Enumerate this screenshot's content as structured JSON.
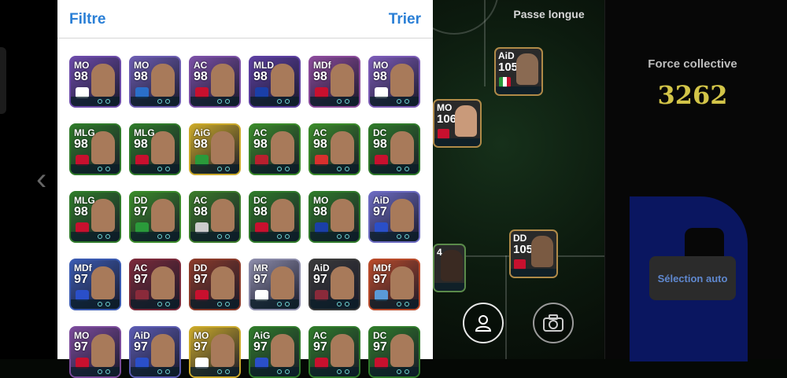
{
  "header": {
    "filter_label": "Filtre",
    "sort_label": "Trier"
  },
  "pitch": {
    "stat_label": "Passe longue"
  },
  "team": {
    "strength_label": "Force collective",
    "strength_value": "3262",
    "auto_select_label": "Sélection auto"
  },
  "nav": {
    "back_icon": "chevron-left-icon"
  },
  "buttons": {
    "profile_icon": "person-icon",
    "camera_icon": "camera-icon"
  },
  "player_grid": [
    {
      "pos": "MO",
      "rating": "98",
      "bg": "#6b4aa8",
      "emblem": "#ffffff"
    },
    {
      "pos": "MO",
      "rating": "98",
      "bg": "#6b5cb0",
      "emblem": "#2a6fc9"
    },
    {
      "pos": "AC",
      "rating": "98",
      "bg": "#7a4fa5",
      "emblem": "#c8102e"
    },
    {
      "pos": "MLD",
      "rating": "98",
      "bg": "#5c3fa0",
      "emblem": "#1a3fa8"
    },
    {
      "pos": "MDf",
      "rating": "98",
      "bg": "#8a4a9a",
      "emblem": "#c8102e"
    },
    {
      "pos": "MO",
      "rating": "98",
      "bg": "#7a5ab5",
      "emblem": "#ffffff"
    },
    {
      "pos": "MLG",
      "rating": "98",
      "bg": "#2f7a2a",
      "emblem": "#c8102e"
    },
    {
      "pos": "MLG",
      "rating": "98",
      "bg": "#2f7a2a",
      "emblem": "#c8102e"
    },
    {
      "pos": "AiG",
      "rating": "98",
      "bg": "#c9a82a",
      "emblem": "#2a9a3a"
    },
    {
      "pos": "AC",
      "rating": "98",
      "bg": "#3a8a2a",
      "emblem": "#b8202e"
    },
    {
      "pos": "AC",
      "rating": "98",
      "bg": "#3a8a2a",
      "emblem": "#d8302e"
    },
    {
      "pos": "DC",
      "rating": "98",
      "bg": "#2f7a2a",
      "emblem": "#c8102e"
    },
    {
      "pos": "MLG",
      "rating": "98",
      "bg": "#2f7a2a",
      "emblem": "#c8102e"
    },
    {
      "pos": "DD",
      "rating": "97",
      "bg": "#3a8a2a",
      "emblem": "#2a9a3a"
    },
    {
      "pos": "AC",
      "rating": "98",
      "bg": "#3a7a2a",
      "emblem": "#cccccc"
    },
    {
      "pos": "DC",
      "rating": "98",
      "bg": "#2f7a2a",
      "emblem": "#c8102e"
    },
    {
      "pos": "MO",
      "rating": "98",
      "bg": "#2f7a2a",
      "emblem": "#1a3fa8"
    },
    {
      "pos": "AiD",
      "rating": "97",
      "bg": "#6b6ac0",
      "emblem": "#2a4fc9"
    },
    {
      "pos": "MDf",
      "rating": "97",
      "bg": "#3a5ab0",
      "emblem": "#2a4fc9"
    },
    {
      "pos": "AC",
      "rating": "97",
      "bg": "#7a2a3a",
      "emblem": "#8a2a3a"
    },
    {
      "pos": "DD",
      "rating": "97",
      "bg": "#8a3a2a",
      "emblem": "#c8102e"
    },
    {
      "pos": "MR",
      "rating": "97",
      "bg": "#8a8aa8",
      "emblem": "#ffffff"
    },
    {
      "pos": "AiD",
      "rating": "97",
      "bg": "#3a3a3a",
      "emblem": "#8a2a3a"
    },
    {
      "pos": "MDf",
      "rating": "97",
      "bg": "#b84a2a",
      "emblem": "#5a9ad8"
    },
    {
      "pos": "MO",
      "rating": "97",
      "bg": "#7a4a9a",
      "emblem": "#c8102e"
    },
    {
      "pos": "AiD",
      "rating": "97",
      "bg": "#5a5ab0",
      "emblem": "#2a4fc9"
    },
    {
      "pos": "MO",
      "rating": "97",
      "bg": "#c9a82a",
      "emblem": "#ffffff"
    },
    {
      "pos": "AiG",
      "rating": "97",
      "bg": "#2f7a2a",
      "emblem": "#2a4fc9"
    },
    {
      "pos": "AC",
      "rating": "97",
      "bg": "#2f7a2a",
      "emblem": "#c8102e"
    },
    {
      "pos": "DC",
      "rating": "97",
      "bg": "#2f7a2a",
      "emblem": "#c8102e"
    }
  ],
  "pitch_players": [
    {
      "pos": "AiD",
      "rating": "105",
      "bg": "#2a4a2a",
      "emblem": "#2a9a3a"
    },
    {
      "pos": "MO",
      "rating": "106",
      "bg": "#2a4a2a",
      "emblem": "#c8102e"
    },
    {
      "pos": "DD",
      "rating": "105",
      "bg": "#3a2a2a",
      "emblem": "#c8102e"
    },
    {
      "pos": "4",
      "rating": "",
      "bg": "#2a3a2a",
      "emblem": "#c8102e"
    }
  ]
}
